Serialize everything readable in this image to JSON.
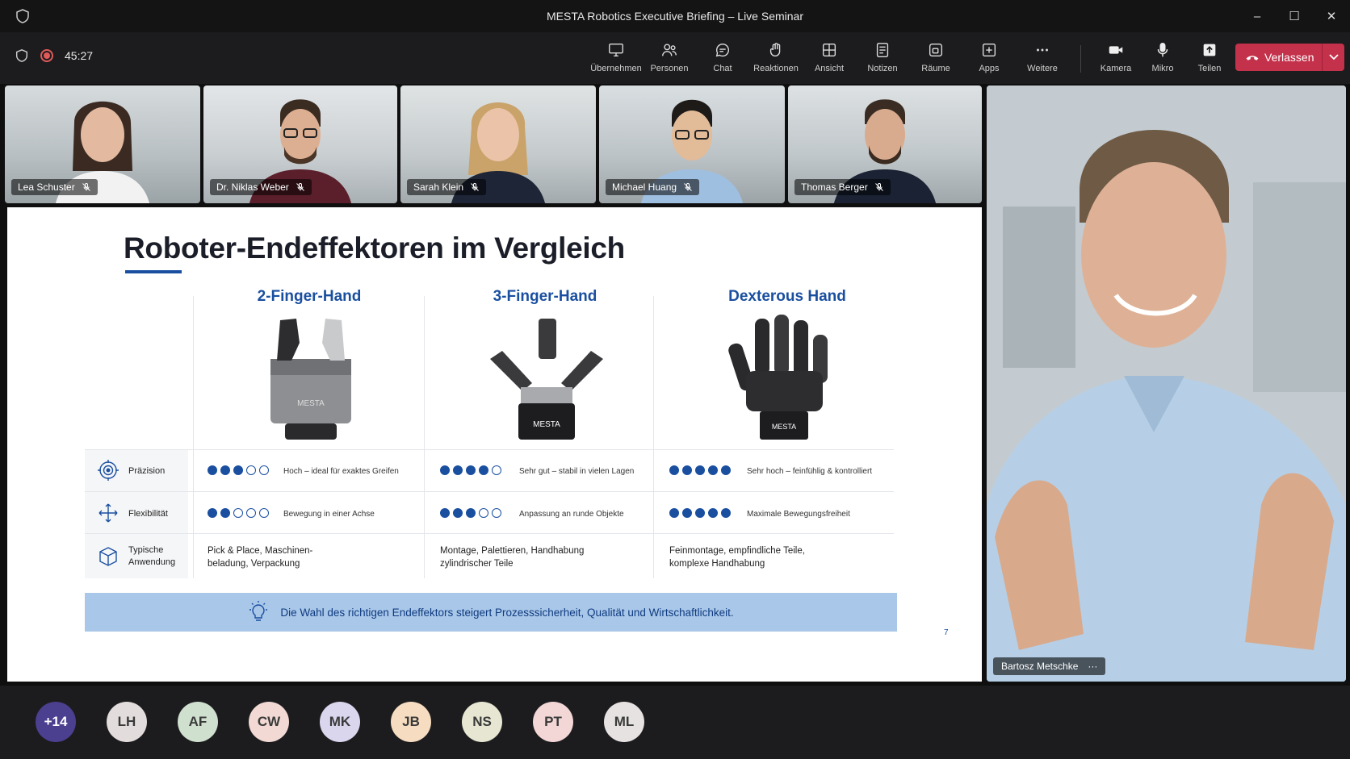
{
  "window": {
    "title": "MESTA Robotics Executive Briefing – Live Seminar",
    "controls": [
      "–",
      "☐",
      "✕"
    ]
  },
  "meeting": {
    "timer": "45:27"
  },
  "toolbar": {
    "items": [
      {
        "label": "Übernehmen",
        "icon": "share-screen-icon"
      },
      {
        "label": "Personen",
        "icon": "people-icon"
      },
      {
        "label": "Chat",
        "icon": "chat-icon"
      },
      {
        "label": "Reaktionen",
        "icon": "reactions-icon"
      },
      {
        "label": "Ansicht",
        "icon": "view-icon"
      },
      {
        "label": "Notizen",
        "icon": "notes-icon"
      },
      {
        "label": "Räume",
        "icon": "rooms-icon"
      },
      {
        "label": "Apps",
        "icon": "apps-icon"
      },
      {
        "label": "Weitere",
        "icon": "more-icon"
      }
    ],
    "media": [
      {
        "label": "Kamera",
        "icon": "camera-icon"
      },
      {
        "label": "Mikro",
        "icon": "microphone-icon"
      },
      {
        "label": "Teilen",
        "icon": "share-icon"
      }
    ],
    "leave_label": "Verlassen"
  },
  "participants": [
    {
      "name": "Lea Schuster"
    },
    {
      "name": "Dr. Niklas Weber"
    },
    {
      "name": "Sarah Klein"
    },
    {
      "name": "Michael Huang"
    },
    {
      "name": "Thomas Berger"
    }
  ],
  "presenter": {
    "name": "Bartosz Metschke",
    "menu": "···"
  },
  "slide": {
    "title": "Roboter-Endeffektoren im Vergleich",
    "columns": [
      {
        "header": "2-Finger-Hand",
        "brand": "MESTA"
      },
      {
        "header": "3-Finger-Hand",
        "brand": "MESTA"
      },
      {
        "header": "Dexterous Hand",
        "brand": "MESTA"
      }
    ],
    "rows": [
      {
        "label": "Präzision",
        "icon": "target-icon",
        "cells": [
          {
            "rating": 3,
            "max": 5,
            "text": "Hoch – ideal für exaktes Greifen"
          },
          {
            "rating": 4,
            "max": 5,
            "text": "Sehr gut – stabil in vielen Lagen"
          },
          {
            "rating": 5,
            "max": 5,
            "text": "Sehr hoch – feinfühlig & kontrolliert"
          }
        ]
      },
      {
        "label": "Flexibilität",
        "icon": "move-arrows-icon",
        "cells": [
          {
            "rating": 2,
            "max": 5,
            "text": "Bewegung in einer Achse"
          },
          {
            "rating": 3,
            "max": 5,
            "text": "Anpassung an runde Objekte"
          },
          {
            "rating": 5,
            "max": 5,
            "text": "Maximale Bewegungsfreiheit"
          }
        ]
      }
    ],
    "application": {
      "label_line1": "Typische",
      "label_line2": "Anwendung",
      "icon": "box-icon",
      "cells": [
        {
          "line1": "Pick & Place, Maschinen-",
          "line2": "beladung, Verpackung"
        },
        {
          "line1": "Montage, Palettieren, Handhabung",
          "line2": "zylindrischer Teile"
        },
        {
          "line1": "Feinmontage, empfindliche Teile,",
          "line2": "komplexe Handhabung"
        }
      ]
    },
    "banner": "Die Wahl des richtigen Endeffektors steigert Prozesssicherheit, Qualität und Wirtschaftlichkeit.",
    "page_number": "7"
  },
  "attendees": [
    {
      "initials": "+14",
      "color": "#4b3f8f"
    },
    {
      "initials": "LH",
      "color": "#e3dcdc"
    },
    {
      "initials": "AF",
      "color": "#cfe0cf"
    },
    {
      "initials": "CW",
      "color": "#f2d9d3"
    },
    {
      "initials": "MK",
      "color": "#d9d6ee"
    },
    {
      "initials": "JB",
      "color": "#f6dcc0"
    },
    {
      "initials": "NS",
      "color": "#e6e6d2"
    },
    {
      "initials": "PT",
      "color": "#f3d6d6"
    },
    {
      "initials": "ML",
      "color": "#e7e2e2"
    }
  ]
}
